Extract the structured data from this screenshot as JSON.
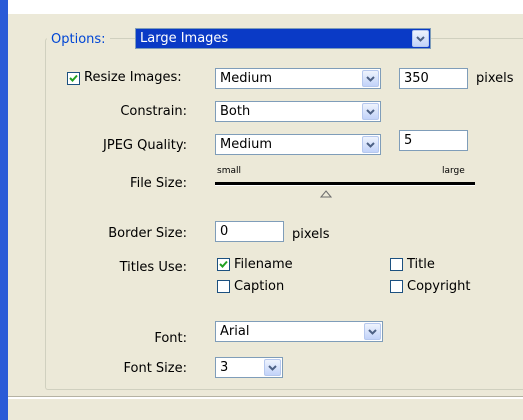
{
  "options": {
    "label": "Options:",
    "value": "Large Images"
  },
  "resize_images": {
    "label": "Resize Images:",
    "checked": true,
    "value": "Medium",
    "pixels_value": "350",
    "unit": "pixels"
  },
  "constrain": {
    "label": "Constrain:",
    "value": "Both"
  },
  "jpeg_quality": {
    "label": "JPEG Quality:",
    "value": "Medium",
    "number": "5"
  },
  "file_size": {
    "label": "File Size:",
    "small_label": "small",
    "large_label": "large",
    "level": 0.4
  },
  "border_size": {
    "label": "Border Size:",
    "value": "0",
    "unit": "pixels"
  },
  "titles_use": {
    "label": "Titles Use:",
    "filename": {
      "label": "Filename",
      "checked": true
    },
    "title": {
      "label": "Title",
      "checked": false
    },
    "caption": {
      "label": "Caption",
      "checked": false
    },
    "copyright": {
      "label": "Copyright",
      "checked": false
    }
  },
  "font": {
    "label": "Font:",
    "value": "Arial"
  },
  "font_size": {
    "label": "Font Size:",
    "value": "3"
  },
  "colors": {
    "accent": "#2a5bd7",
    "panel": "#ece9d8",
    "selection": "#0a3ac6",
    "legend": "#0046d5"
  },
  "icons": [
    "chevron-down-icon",
    "checkmark-icon",
    "slider-thumb-icon"
  ]
}
